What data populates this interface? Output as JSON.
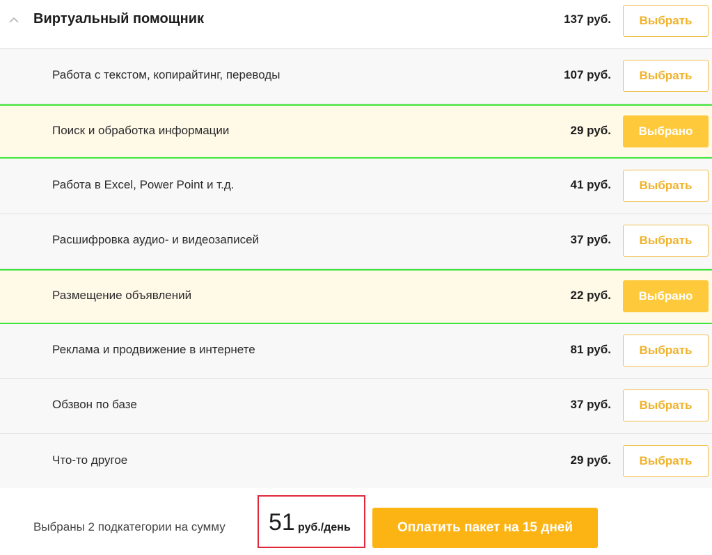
{
  "category": {
    "title": "Виртуальный помощник",
    "price": "137 руб.",
    "button": "Выбрать"
  },
  "items": [
    {
      "label": "Работа с текстом, копирайтинг, переводы",
      "price": "107 руб.",
      "button": "Выбрать",
      "selected": false
    },
    {
      "label": "Поиск и обработка информации",
      "price": "29 руб.",
      "button": "Выбрано",
      "selected": true
    },
    {
      "label": "Работа в Excel, Power Point и т.д.",
      "price": "41 руб.",
      "button": "Выбрать",
      "selected": false
    },
    {
      "label": "Расшифровка аудио- и видеозаписей",
      "price": "37 руб.",
      "button": "Выбрать",
      "selected": false
    },
    {
      "label": "Размещение объявлений",
      "price": "22 руб.",
      "button": "Выбрано",
      "selected": true
    },
    {
      "label": "Реклама и продвижение в интернете",
      "price": "81 руб.",
      "button": "Выбрать",
      "selected": false
    },
    {
      "label": "Обзвон по базе",
      "price": "37 руб.",
      "button": "Выбрать",
      "selected": false
    },
    {
      "label": "Что-то другое",
      "price": "29 руб.",
      "button": "Выбрать",
      "selected": false
    }
  ],
  "footer": {
    "summary": "Выбраны 2 подкатегории на сумму",
    "total": "51",
    "unit": "руб./день",
    "pay_button": "Оплатить пакет на 15 дней"
  },
  "colors": {
    "accent": "#fcb414",
    "selected_button": "#fec93a",
    "selected_border": "#3ee63a",
    "total_highlight": "#e0283a"
  },
  "icons": {
    "collapse": "chevron-up-icon"
  }
}
